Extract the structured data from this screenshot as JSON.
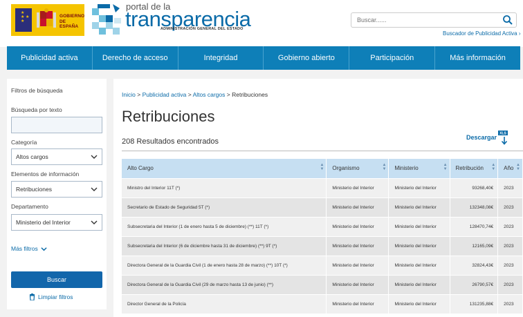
{
  "header": {
    "gov_logo_text": [
      "GOBIERNO",
      "DE ESPAÑA"
    ],
    "portal_prefix": "portal de la",
    "portal_name": "transparencia",
    "portal_subtitle": "ADMINISTRACIÓN GENERAL DEL ESTADO",
    "search_placeholder": "Buscar......",
    "pub_search_link": "Buscador de Publicidad Activa"
  },
  "nav": {
    "items": [
      "Publicidad activa",
      "Derecho de acceso",
      "Integridad",
      "Gobierno abierto",
      "Participación",
      "Más información"
    ]
  },
  "sidebar": {
    "title": "Filtros de búsqueda",
    "text_search_label": "Búsqueda por texto",
    "text_search_value": "",
    "category_label": "Categoría",
    "category_value": "Altos cargos",
    "info_label": "Elementos de información",
    "info_value": "Retribuciones",
    "department_label": "Departamento",
    "department_value": "Ministerio del Interior",
    "more_filters": "Más filtros",
    "search_button": "Buscar",
    "clear_filters": "Limpiar filtros"
  },
  "main": {
    "breadcrumb": [
      "Inicio",
      "Publicidad activa",
      "Altos cargos",
      "Retribuciones"
    ],
    "breadcrumb_sep": ">",
    "title": "Retribuciones",
    "results": "208 Resultados encontrados",
    "download": "Descargar",
    "download_format": "XLS",
    "table": {
      "headers": [
        "Alto Cargo",
        "Organismo",
        "Ministerio",
        "Retribución",
        "Año"
      ],
      "rows": [
        [
          "Ministro del Interior 11T (*)",
          "Ministerio del Interior",
          "Ministerio del Interior",
          "93268,40€",
          "2023"
        ],
        [
          "Secretario de Estado de Seguridad 5T (*)",
          "Ministerio del Interior",
          "Ministerio del Interior",
          "132348,08€",
          "2023"
        ],
        [
          "Subsecretaria del Interior (1 de enero hasta 5 de diciembre) (**) 11T (*)",
          "Ministerio del Interior",
          "Ministerio del Interior",
          "128470,74€",
          "2023"
        ],
        [
          "Subsecretaria del Interior (6 de diciembre hasta 31 de diciembre) (**) 9T (*)",
          "Ministerio del Interior",
          "Ministerio del Interior",
          "12165,09€",
          "2023"
        ],
        [
          "Directora General de la Guardia Civil (1 de enero hasta 28 de marzo) (**) 10T (*)",
          "Ministerio del Interior",
          "Ministerio del Interior",
          "32824,43€",
          "2023"
        ],
        [
          "Directora General de la Guardia Civil (29 de marzo hasta 13 de junio) (**)",
          "Ministerio del Interior",
          "Ministerio del Interior",
          "26790,57€",
          "2023"
        ],
        [
          "Director General de la Policía",
          "Ministerio del Interior",
          "Ministerio del Interior",
          "131235,88€",
          "2023"
        ]
      ]
    }
  },
  "colors": {
    "nav": "#0e7fb8",
    "link": "#0b6ba8",
    "button": "#1266ab",
    "table_header": "#c6dff2"
  }
}
